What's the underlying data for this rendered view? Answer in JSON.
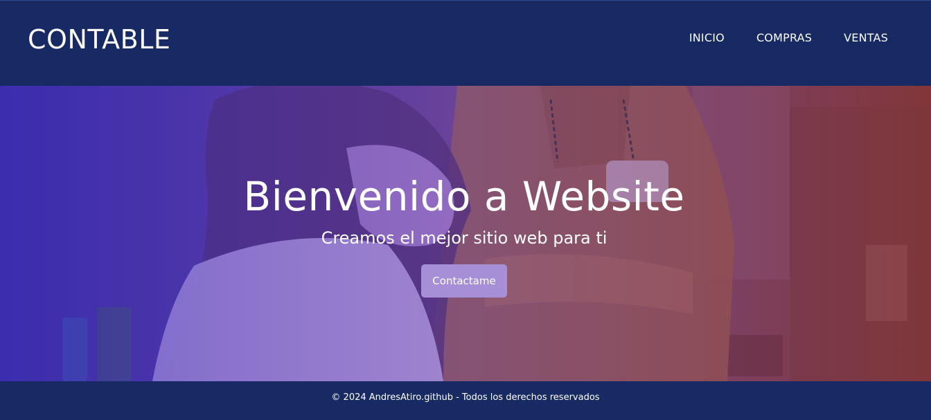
{
  "header": {
    "brand": "CONTABLE",
    "nav": [
      {
        "label": "INICIO"
      },
      {
        "label": "COMPRAS"
      },
      {
        "label": "VENTAS"
      }
    ]
  },
  "hero": {
    "title": "Bienvenido a Website",
    "subtitle": "Creamos el mejor sitio web para ti",
    "cta_label": "Contactame"
  },
  "footer": {
    "copyright": "© 2024 AndresAtiro.github - Todos los derechos reservados"
  },
  "colors": {
    "header_bg": "#172a63",
    "cta_bg": "#a68fd6",
    "text": "#ffffff"
  }
}
